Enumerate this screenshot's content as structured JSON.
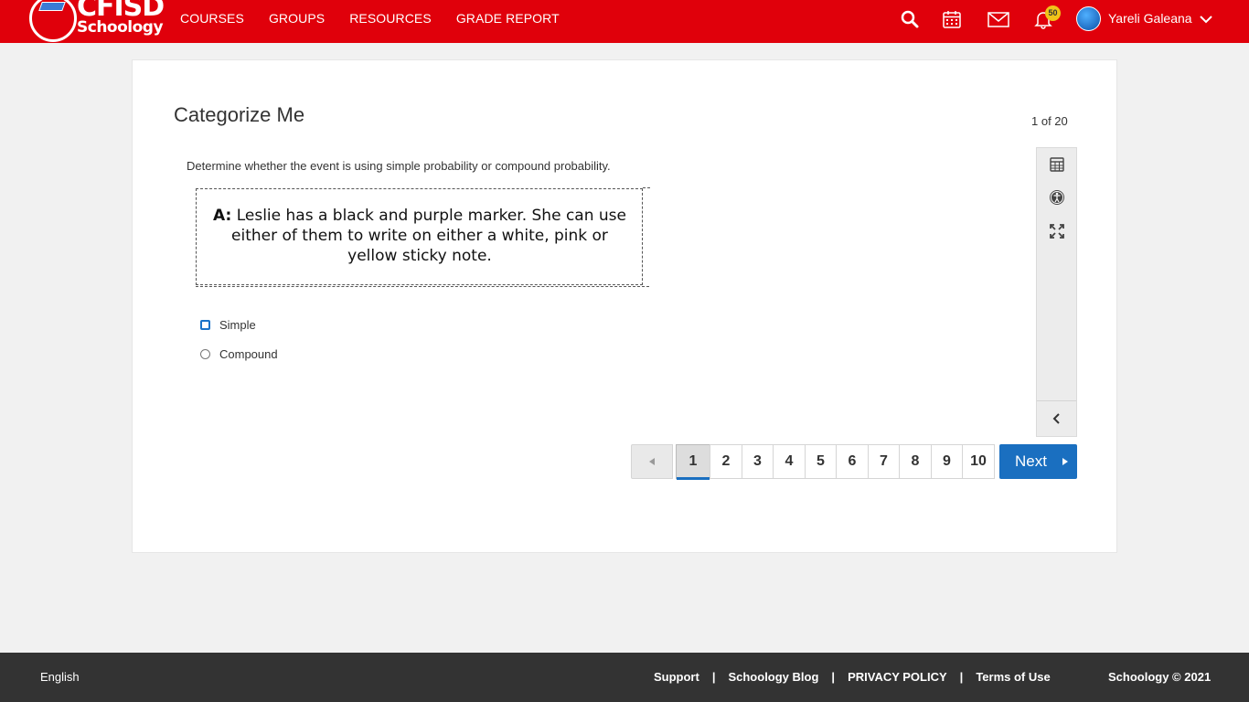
{
  "header": {
    "logo_text_top": "CFISD",
    "logo_text_bottom": "Schoology",
    "nav": [
      "COURSES",
      "GROUPS",
      "RESOURCES",
      "GRADE REPORT"
    ],
    "notification_count": "50",
    "user_name": "Yareli Galeana",
    "icons": [
      "search-icon",
      "calendar-icon",
      "mail-icon",
      "bell-icon",
      "chevron-down-icon"
    ],
    "brand_color": "#e0000b"
  },
  "assessment": {
    "title": "Categorize Me",
    "counter": "1 of 20",
    "question": "Determine whether the event is using simple probability or compound probability.",
    "prompt_label": "A:",
    "prompt_body": "Leslie has a black and purple marker.  She can use either of them to write on either a white, pink or yellow sticky note.",
    "options": [
      "Simple",
      "Compound"
    ],
    "selected_option": null,
    "tools": [
      "calculator-icon",
      "accessibility-icon",
      "fullscreen-icon",
      "collapse-chevron-icon"
    ]
  },
  "pager": {
    "pages": [
      "1",
      "2",
      "3",
      "4",
      "5",
      "6",
      "7",
      "8",
      "9",
      "10"
    ],
    "current_page": "1",
    "next_label": "Next",
    "accent_color": "#1a6fc0"
  },
  "footer": {
    "language": "English",
    "links": [
      "Support",
      "Schoology Blog",
      "PRIVACY POLICY",
      "Terms of Use"
    ],
    "separator": "|",
    "copyright": "Schoology © 2021"
  }
}
